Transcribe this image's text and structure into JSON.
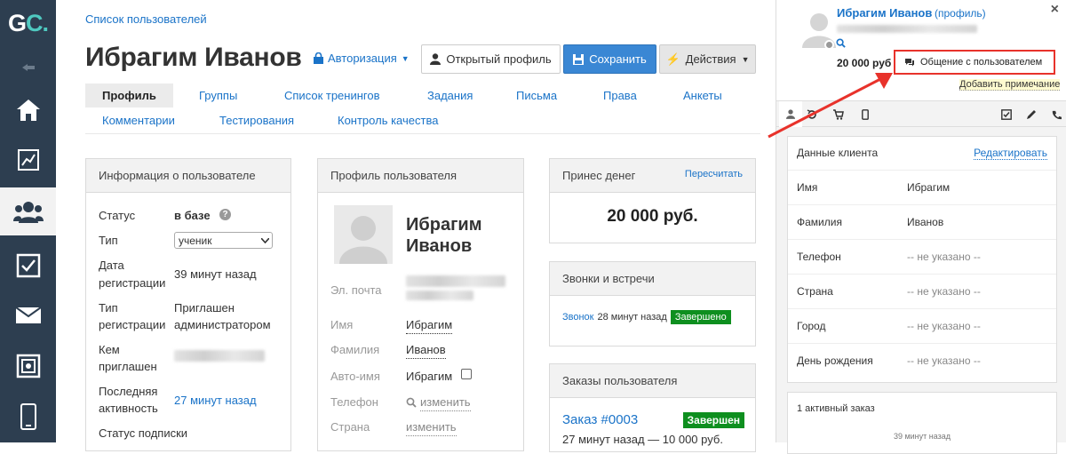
{
  "sidebar": {
    "logo_g": "G",
    "logo_c": "C.",
    "items": [
      "home-icon",
      "chart-icon",
      "users-icon",
      "checkbox-icon",
      "mail-icon",
      "safe-icon",
      "phone-icon"
    ]
  },
  "breadcrumb": "Список пользователей",
  "title": "Ибрагим Иванов",
  "auth_label": "Авторизация",
  "buttons": {
    "open_profile": "Открытый профиль",
    "save": "Сохранить",
    "actions": "Действия"
  },
  "tabs": [
    "Профиль",
    "Группы",
    "Список тренингов",
    "Задания",
    "Письма",
    "Права",
    "Анкеты",
    "Комментарии",
    "Тестирования",
    "Контроль качества"
  ],
  "info_panel": {
    "header": "Информация о пользователе",
    "status_label": "Статус",
    "status_value": "в базе",
    "type_label": "Тип",
    "type_value": "ученик",
    "reg_date_label_1": "Дата",
    "reg_date_label_2": "регистрации",
    "reg_date_value": "39 минут назад",
    "reg_type_label_1": "Тип",
    "reg_type_label_2": "регистрации",
    "reg_type_value_1": "Приглашен",
    "reg_type_value_2": "администратором",
    "invited_label_1": "Кем",
    "invited_label_2": "приглашен",
    "activity_label_1": "Последняя",
    "activity_label_2": "активность",
    "activity_value": "27 минут назад",
    "subscription_label": "Статус подписки"
  },
  "profile_panel": {
    "header": "Профиль пользователя",
    "name_1": "Ибрагим",
    "name_2": "Иванов",
    "email_label": "Эл. почта",
    "first_label": "Имя",
    "first_value": "Ибрагим",
    "last_label": "Фамилия",
    "last_value": "Иванов",
    "auto_label": "Авто-имя",
    "auto_value": "Ибрагим",
    "phone_label": "Телефон",
    "phone_link": "изменить",
    "country_label": "Страна",
    "country_link": "изменить"
  },
  "money_panel": {
    "header": "Принес денег",
    "recalc": "Пересчитать",
    "amount": "20 000 руб."
  },
  "calls_panel": {
    "header": "Звонки и встречи",
    "call_link": "Звонок",
    "call_time": "28 минут назад",
    "call_status": "Завершено"
  },
  "orders_panel": {
    "header": "Заказы пользователя",
    "order_link": "Заказ #0003",
    "order_status": "Завершен",
    "order_meta": "27 минут назад — 10 000 руб."
  },
  "right_panel": {
    "name": "Ибрагим Иванов",
    "profile_link": "(профиль)",
    "money": "20 000 руб",
    "chat_button": "Общение с пользователем",
    "add_note": "Добавить примечание",
    "close": "×",
    "client_header": "Данные клиента",
    "edit": "Редактировать",
    "rows": [
      {
        "k": "Имя",
        "v": "Ибрагим"
      },
      {
        "k": "Фамилия",
        "v": "Иванов"
      },
      {
        "k": "Телефон",
        "v": "-- не указано --"
      },
      {
        "k": "Страна",
        "v": "-- не указано --"
      },
      {
        "k": "Город",
        "v": "-- не указано --"
      },
      {
        "k": "День рождения",
        "v": "-- не указано --"
      }
    ],
    "active_orders": "1 активный заказ",
    "orders_time": "39 минут назад"
  },
  "colors": {
    "sidebar": "#2d3e50",
    "link": "#1a73c8",
    "primary": "#3a87d4",
    "success": "#0e8f1f",
    "highlight": "#e8322b"
  }
}
